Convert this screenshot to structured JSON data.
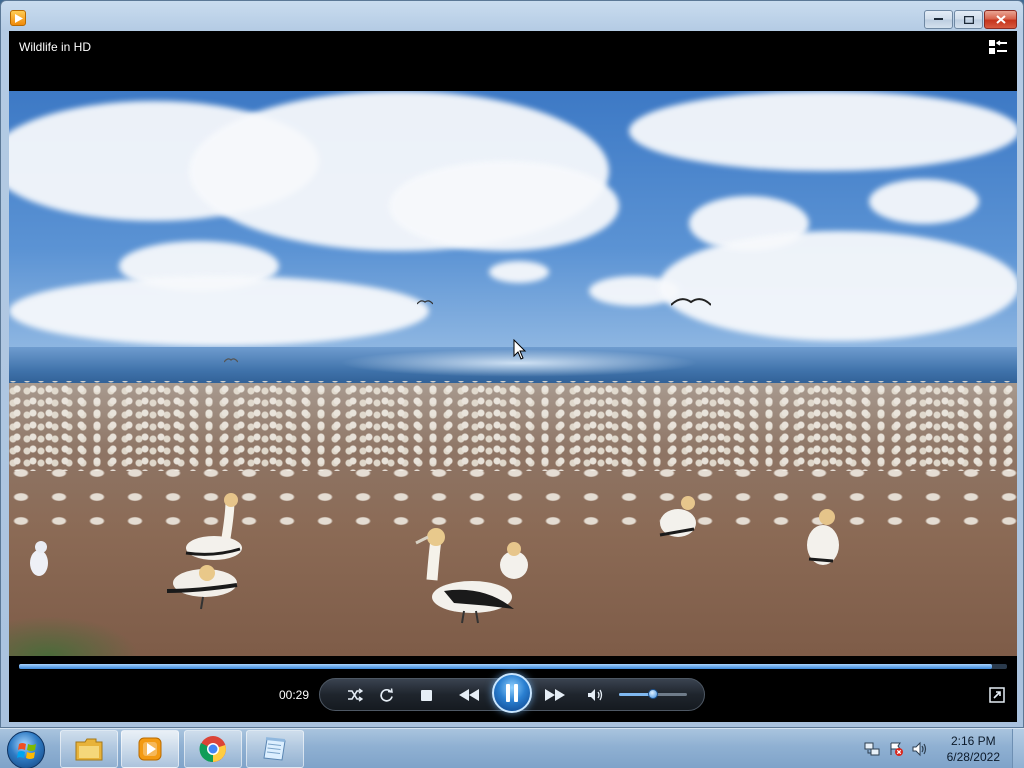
{
  "window": {
    "title_icon": "media-player-icon",
    "buttons": [
      "minimize",
      "maximize",
      "close"
    ]
  },
  "player": {
    "media_title": "Wildlife in HD",
    "current_time": "00:29",
    "progress_fraction": 0.985,
    "volume_fraction": 0.5,
    "state": "playing",
    "controls": [
      "shuffle",
      "repeat",
      "stop",
      "previous",
      "play-pause",
      "next",
      "mute",
      "volume",
      "fullscreen"
    ]
  },
  "taskbar": {
    "pinned": [
      "windows-explorer",
      "windows-media-player",
      "google-chrome",
      "notepad"
    ],
    "clock_time": "2:16 PM",
    "clock_date": "6/28/2022",
    "tray_icons": [
      "network-icon",
      "action-center-icon",
      "volume-icon"
    ]
  },
  "colors": {
    "accent": "#2a7fd0",
    "close_button": "#c5341c",
    "seek_fill": "#3a86d8"
  }
}
